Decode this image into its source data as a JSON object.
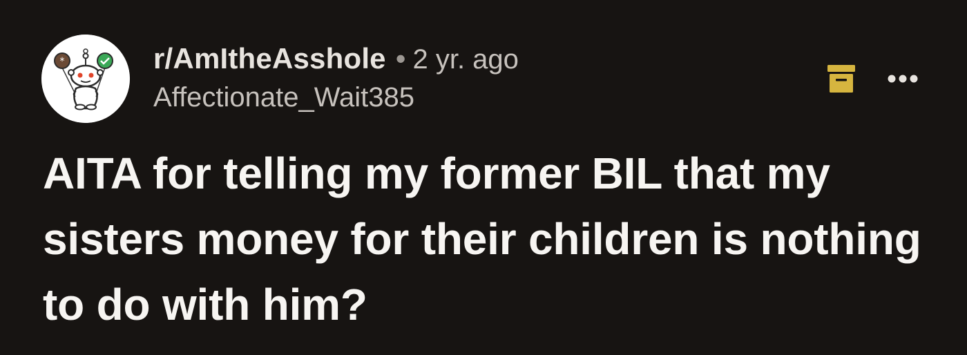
{
  "post": {
    "subreddit": "r/AmItheAsshole",
    "separator": "•",
    "age": "2 yr. ago",
    "author": "Affectionate_Wait385",
    "title": "AITA for telling my former BIL that my sisters money for their children is nothing to do with him?"
  },
  "icons": {
    "avatar": "reddit-snoo-avatar-icon",
    "archive": "archive-box-icon",
    "more": "more-options-icon"
  },
  "colors": {
    "background": "#171412",
    "archive_icon": "#d6b53f",
    "primary_text": "#f7f5f2",
    "secondary_text": "#c7c2bd"
  }
}
